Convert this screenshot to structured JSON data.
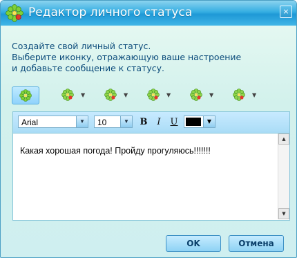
{
  "window": {
    "title": "Редактор личного статуса",
    "close_glyph": "×"
  },
  "intro": {
    "line1": "Создайте свой личный статус.",
    "line2": "Выберите иконку, отражающую ваше настроение",
    "line3": "и добавьте сообщение к статусу."
  },
  "status_icons": [
    {
      "icon": "green-flower-icon",
      "selected": true
    },
    {
      "icon": "status-flower-icon",
      "selected": false
    },
    {
      "icon": "status-flower-icon",
      "selected": false
    },
    {
      "icon": "status-flower-icon",
      "selected": false
    },
    {
      "icon": "status-flower-icon",
      "selected": false
    },
    {
      "icon": "status-flower-icon",
      "selected": false
    }
  ],
  "toolbar": {
    "font_name": "Arial",
    "font_size": "10",
    "bold": "B",
    "italic": "I",
    "underline": "U",
    "text_color": "#000000",
    "dropdown_glyph": "▼"
  },
  "editor": {
    "message": "Какая хорошая погода! Пройду прогуляюсь!!!!!!!"
  },
  "buttons": {
    "ok_label": "OK",
    "cancel_label": "Отмена"
  },
  "colors": {
    "title_bar": "#2aa6de",
    "accent": "#8ed2f4",
    "text": "#0a4a7a"
  }
}
